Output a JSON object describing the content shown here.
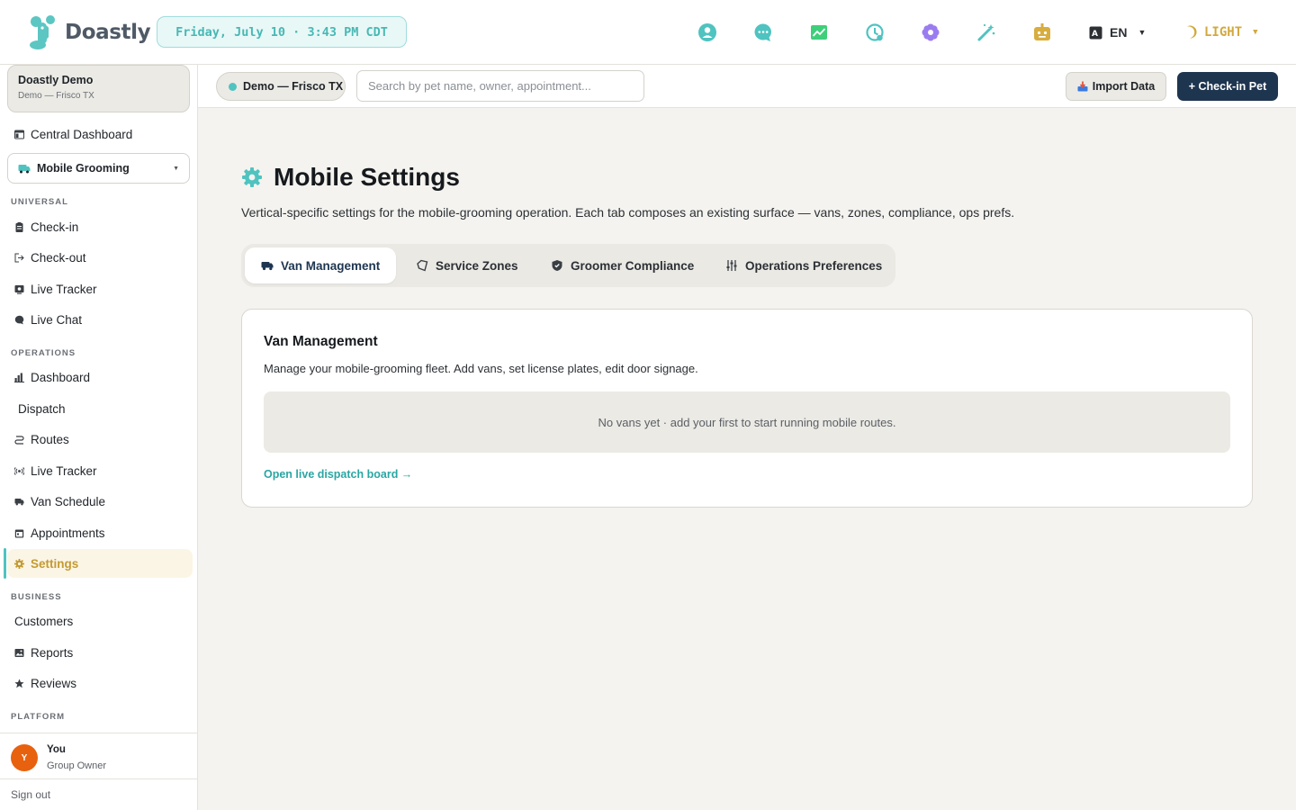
{
  "header": {
    "logo_text": "Doastly",
    "date_time": "Friday, July 10 · 3:43 PM CDT",
    "icons": [
      "support-icon",
      "chat-icon",
      "analytics-icon",
      "history-icon",
      "flower-icon",
      "magic-wand-icon",
      "robot-icon"
    ],
    "language": "EN",
    "theme": "LIGHT"
  },
  "org": {
    "name": "Doastly Demo",
    "location": "Demo — Frisco TX"
  },
  "sidebar": {
    "central_dashboard": "Central Dashboard",
    "vertical_selector": "Mobile Grooming",
    "sections": {
      "universal": "UNIVERSAL",
      "operations": "OPERATIONS",
      "business": "BUSINESS",
      "platform": "PLATFORM"
    },
    "universal_items": [
      {
        "label": "Check-in",
        "icon": "clipboard-icon"
      },
      {
        "label": "Check-out",
        "icon": "exit-icon"
      },
      {
        "label": "Live Tracker",
        "icon": "tracker-icon"
      },
      {
        "label": "Live Chat",
        "icon": "chat-bubble-icon"
      }
    ],
    "operations_items": [
      {
        "label": "Dashboard",
        "icon": "bar-chart-icon"
      },
      {
        "label": "Dispatch",
        "icon": ""
      },
      {
        "label": "Routes",
        "icon": "route-icon"
      },
      {
        "label": "Live Tracker",
        "icon": "broadcast-icon"
      },
      {
        "label": "Van Schedule",
        "icon": "van-icon"
      },
      {
        "label": "Appointments",
        "icon": "calendar-icon"
      },
      {
        "label": "Settings",
        "icon": "gear-icon",
        "active": true
      }
    ],
    "business_items": [
      {
        "label": "Customers",
        "icon": ""
      },
      {
        "label": "Reports",
        "icon": "image-icon"
      },
      {
        "label": "Reviews",
        "icon": "star-icon"
      }
    ],
    "user": {
      "initial": "Y",
      "name": "You",
      "role": "Group Owner"
    },
    "sign_out": "Sign out"
  },
  "subheader": {
    "location_chip": "Demo — Frisco TX",
    "search_placeholder": "Search by pet name, owner, appointment...",
    "import_button": "Import Data",
    "checkin_button": "+ Check-in Pet"
  },
  "main": {
    "title": "Mobile Settings",
    "description": "Vertical-specific settings for the mobile-grooming operation. Each tab composes an existing surface — vans, zones, compliance, ops prefs.",
    "tabs": [
      {
        "label": "Van Management",
        "icon": "van-icon",
        "active": true
      },
      {
        "label": "Service Zones",
        "icon": "zone-icon"
      },
      {
        "label": "Groomer Compliance",
        "icon": "shield-icon"
      },
      {
        "label": "Operations Preferences",
        "icon": "sliders-icon"
      }
    ],
    "card": {
      "title": "Van Management",
      "description": "Manage your mobile-grooming fleet. Add vans, set license plates, edit door signage.",
      "empty_state": "No vans yet · add your first to start running mobile routes.",
      "link": "Open live dispatch board →"
    }
  },
  "colors": {
    "accent_teal": "#4fc3c0",
    "navy": "#1e3550",
    "active_gold": "#c39a32",
    "avatar_orange": "#e8610e"
  }
}
